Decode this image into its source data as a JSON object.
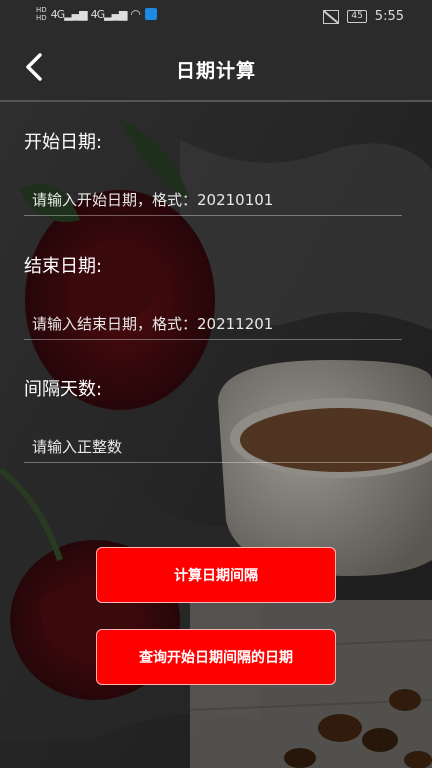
{
  "status_bar": {
    "network_1": "4G",
    "network_2": "4G",
    "battery": "45",
    "time": "5:55"
  },
  "header": {
    "title": "日期计算",
    "back_icon": "chevron-left-icon"
  },
  "form": {
    "start_date": {
      "label": "开始日期:",
      "value": "",
      "placeholder": "请输入开始日期，格式：20210101"
    },
    "end_date": {
      "label": "结束日期:",
      "value": "",
      "placeholder": "请输入结束日期，格式：20211201"
    },
    "interval_days": {
      "label": "间隔天数:",
      "value": "",
      "placeholder": "请输入正整数"
    }
  },
  "actions": {
    "calc_interval_label": "计算日期间隔",
    "query_date_label": "查询开始日期间隔的日期"
  },
  "colors": {
    "bar_bg": "#2b2b2b",
    "button_bg": "#ff0000",
    "text": "#ffffff"
  }
}
